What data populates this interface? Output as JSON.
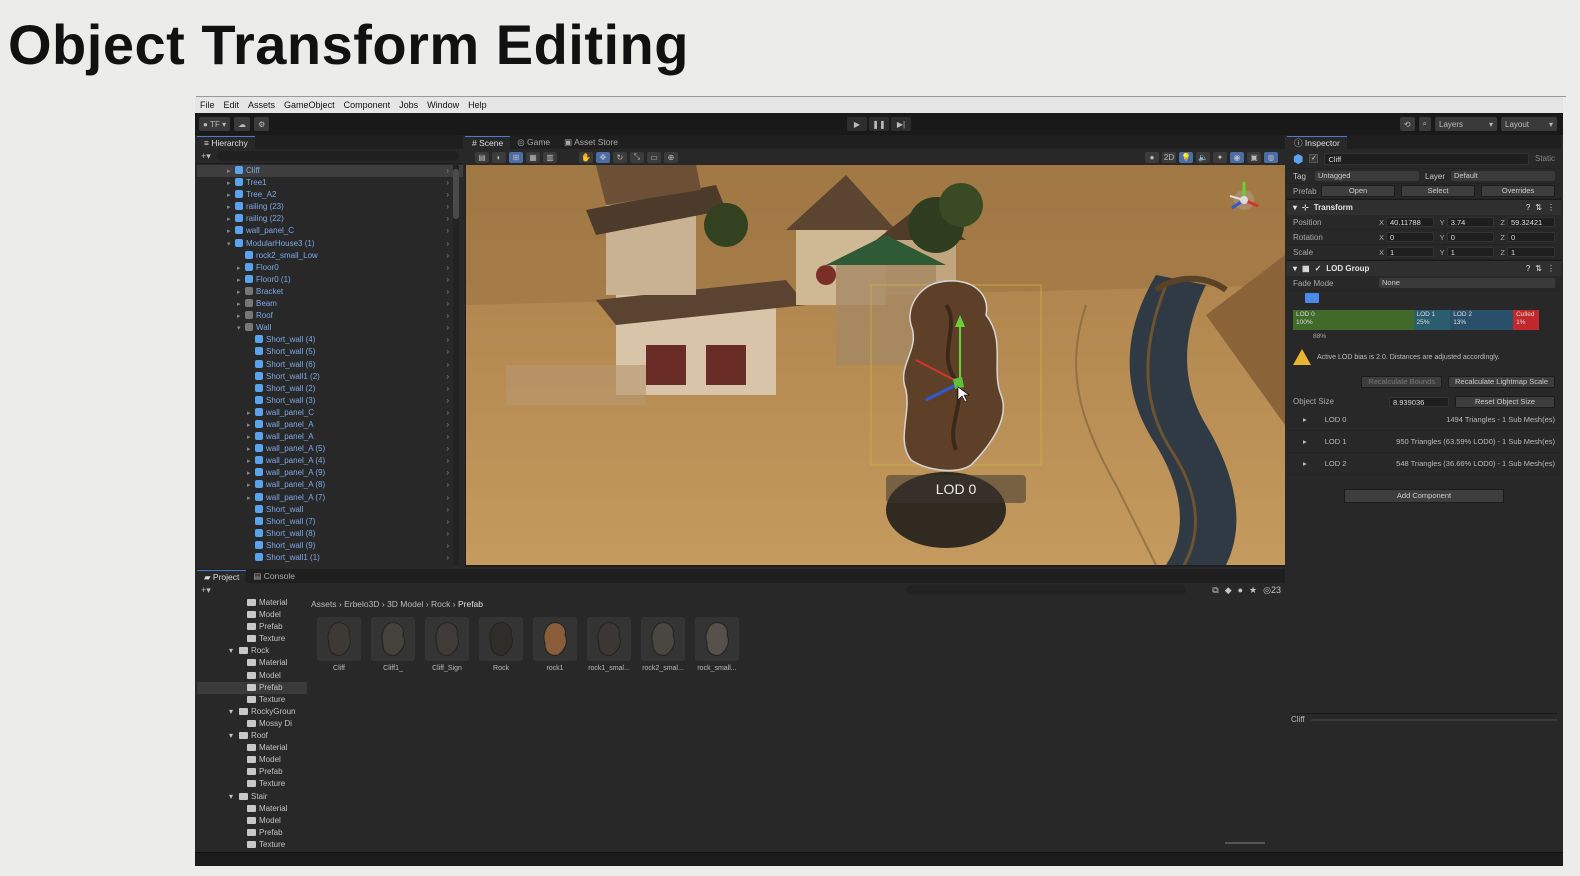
{
  "slide": {
    "title": "Object Transform Editing"
  },
  "menu": [
    "File",
    "Edit",
    "Assets",
    "GameObject",
    "Component",
    "Jobs",
    "Window",
    "Help"
  ],
  "toolbar": {
    "account": "TF",
    "layers": "Layers",
    "layout": "Layout"
  },
  "hierarchy": {
    "tab": "Hierarchy",
    "items": [
      {
        "label": "Cliff",
        "indent": 1,
        "selected": true,
        "arrow": true
      },
      {
        "label": "Tree1",
        "indent": 1,
        "arrow": true
      },
      {
        "label": "Tree_A2",
        "indent": 1,
        "arrow": true
      },
      {
        "label": "railing (23)",
        "indent": 1,
        "arrow": true
      },
      {
        "label": "railing (22)",
        "indent": 1,
        "arrow": true
      },
      {
        "label": "wall_panel_C",
        "indent": 1,
        "arrow": true
      },
      {
        "label": "ModularHouse3 (1)",
        "indent": 1,
        "arrow": true
      },
      {
        "label": "rock2_small_Low",
        "indent": 2
      },
      {
        "label": "Floor0",
        "indent": 2,
        "arrow": true
      },
      {
        "label": "Floor0 (1)",
        "indent": 2,
        "arrow": true
      },
      {
        "label": "Bracket",
        "indent": 2,
        "arrow": true,
        "grey": true
      },
      {
        "label": "Beam",
        "indent": 2,
        "arrow": true,
        "grey": true
      },
      {
        "label": "Roof",
        "indent": 2,
        "arrow": true,
        "grey": true
      },
      {
        "label": "Wall",
        "indent": 2,
        "arrow": true,
        "grey": true
      },
      {
        "label": "Short_wall (4)",
        "indent": 3
      },
      {
        "label": "Short_wall (5)",
        "indent": 3
      },
      {
        "label": "Short_wall (6)",
        "indent": 3
      },
      {
        "label": "Short_wall1 (2)",
        "indent": 3
      },
      {
        "label": "Short_wall (2)",
        "indent": 3
      },
      {
        "label": "Short_wall (3)",
        "indent": 3
      },
      {
        "label": "wall_panel_C",
        "indent": 3,
        "arrow": true
      },
      {
        "label": "wall_panel_A",
        "indent": 3,
        "arrow": true
      },
      {
        "label": "wall_panel_A",
        "indent": 3,
        "arrow": true
      },
      {
        "label": "wall_panel_A (5)",
        "indent": 3,
        "arrow": true
      },
      {
        "label": "wall_panel_A (4)",
        "indent": 3,
        "arrow": true
      },
      {
        "label": "wall_panel_A (9)",
        "indent": 3,
        "arrow": true
      },
      {
        "label": "wall_panel_A (8)",
        "indent": 3,
        "arrow": true
      },
      {
        "label": "wall_panel_A (7)",
        "indent": 3,
        "arrow": true
      },
      {
        "label": "Short_wall",
        "indent": 3
      },
      {
        "label": "Short_wall (7)",
        "indent": 3
      },
      {
        "label": "Short_wall (8)",
        "indent": 3
      },
      {
        "label": "Short_wall (9)",
        "indent": 3
      },
      {
        "label": "Short_wall1 (1)",
        "indent": 3
      }
    ]
  },
  "scene": {
    "tabs": [
      "Scene",
      "Game",
      "Asset Store"
    ],
    "view_toggle": "2D",
    "lod_label": "LOD 0"
  },
  "inspector": {
    "tab": "Inspector",
    "object_name": "Cliff",
    "static_label": "Static",
    "tag_label": "Tag",
    "tag_value": "Untagged",
    "layer_label": "Layer",
    "layer_value": "Default",
    "prefab_label": "Prefab",
    "prefab_open": "Open",
    "prefab_select": "Select",
    "prefab_overrides": "Overrides",
    "transform_title": "Transform",
    "position_label": "Position",
    "position": {
      "x": "40.11788",
      "y": "3.74",
      "z": "59.32421"
    },
    "rotation_label": "Rotation",
    "rotation": {
      "x": "0",
      "y": "0",
      "z": "0"
    },
    "scale_label": "Scale",
    "scale": {
      "x": "1",
      "y": "1",
      "z": "1"
    },
    "lod_group_title": "LOD Group",
    "fade_mode_label": "Fade Mode",
    "fade_mode_value": "None",
    "lod_bar": [
      {
        "name": "LOD 0",
        "pct": "100%",
        "color": "#3f6a2a"
      },
      {
        "name": "LOD 1",
        "pct": "25%",
        "color": "#2c5d6e"
      },
      {
        "name": "LOD 2",
        "pct": "13%",
        "color": "#2a4f6a"
      },
      {
        "name": "Culled",
        "pct": "1%",
        "color": "#c0282b"
      }
    ],
    "lod_bar_marker": "88%",
    "warning_text": "Active LOD bias is 2.0. Distances are adjusted accordingly.",
    "recalc_bounds": "Recalculate Bounds",
    "recalc_lightmap": "Recalculate Lightmap Scale",
    "object_size_label": "Object Size",
    "object_size_value": "8.939036",
    "reset_object_size": "Reset Object Size",
    "lods": [
      {
        "name": "LOD 0",
        "info": "1494 Triangles  - 1 Sub Mesh(es)"
      },
      {
        "name": "LOD 1",
        "info": "950 Triangles (63.59% LOD0) - 1 Sub Mesh(es)"
      },
      {
        "name": "LOD 2",
        "info": "548 Triangles (36.66% LOD0) - 1 Sub Mesh(es)"
      }
    ],
    "add_component": "Add Component",
    "preview_label": "Cliff"
  },
  "project": {
    "tabs": [
      "Project",
      "Console"
    ],
    "count": "23",
    "folders": [
      {
        "label": "Material",
        "indent": 2
      },
      {
        "label": "Model",
        "indent": 2
      },
      {
        "label": "Prefab",
        "indent": 2
      },
      {
        "label": "Texture",
        "indent": 2
      },
      {
        "label": "Rock",
        "indent": 1,
        "open": true
      },
      {
        "label": "Material",
        "indent": 2
      },
      {
        "label": "Model",
        "indent": 2
      },
      {
        "label": "Prefab",
        "indent": 2,
        "selected": true
      },
      {
        "label": "Texture",
        "indent": 2
      },
      {
        "label": "RockyGroun",
        "indent": 1,
        "open": true
      },
      {
        "label": "Mossy Di",
        "indent": 2
      },
      {
        "label": "Roof",
        "indent": 1,
        "open": true
      },
      {
        "label": "Material",
        "indent": 2
      },
      {
        "label": "Model",
        "indent": 2
      },
      {
        "label": "Prefab",
        "indent": 2
      },
      {
        "label": "Texture",
        "indent": 2
      },
      {
        "label": "Stair",
        "indent": 1,
        "open": true
      },
      {
        "label": "Material",
        "indent": 2
      },
      {
        "label": "Model",
        "indent": 2
      },
      {
        "label": "Prefab",
        "indent": 2
      },
      {
        "label": "Texture",
        "indent": 2
      }
    ],
    "breadcrumb": [
      "Assets",
      "Erbelo3D",
      "3D Model",
      "Rock",
      "Prefab"
    ],
    "assets": [
      "Cliff",
      "Cliff1_",
      "Cliff_Sign",
      "Rock",
      "rock1",
      "rock1_smal...",
      "rock2_smal...",
      "rock_small..."
    ]
  }
}
